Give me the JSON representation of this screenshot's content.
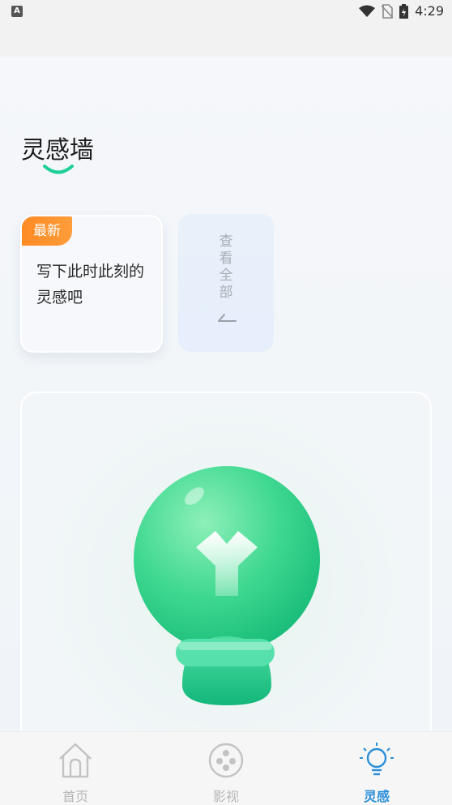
{
  "status": {
    "time": "4:29"
  },
  "page": {
    "title": "灵感墙"
  },
  "latest_card": {
    "badge": "最新",
    "text": "写下此时此刻的灵感吧"
  },
  "view_all": {
    "label": "查看全部"
  },
  "tabs": [
    {
      "label": "首页",
      "icon": "home-icon",
      "active": false
    },
    {
      "label": "影视",
      "icon": "film-reel-icon",
      "active": false
    },
    {
      "label": "灵感",
      "icon": "lightbulb-icon",
      "active": true
    }
  ],
  "colors": {
    "accent_green": "#1fcf97",
    "badge_orange": "#ff8a24",
    "active_tab": "#2a8fd8"
  }
}
